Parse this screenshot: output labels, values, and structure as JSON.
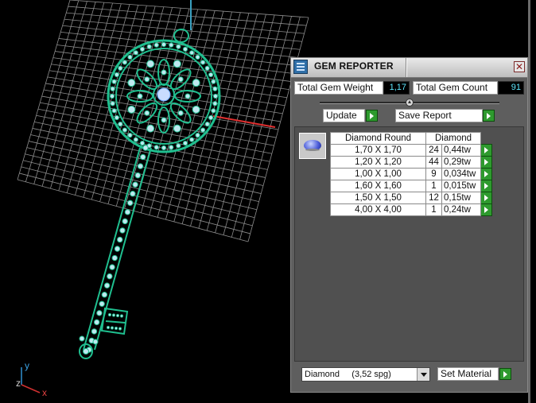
{
  "viewport": {
    "axis_labels": {
      "y": "y",
      "z": "z",
      "x": "x"
    },
    "colors": {
      "background": "#000000",
      "grid": "#8c8c8c",
      "model": "#1fbf8f",
      "axis_x": "#e03030",
      "axis_y": "#30a0e0"
    }
  },
  "panel": {
    "title": "GEM REPORTER",
    "close_icon": "close-x-icon",
    "total_gem_weight_label": "Total Gem Weight",
    "total_gem_weight_value": "1,17",
    "total_gem_count_label": "Total Gem Count",
    "total_gem_count_value": "91",
    "update_label": "Update",
    "save_report_label": "Save Report",
    "table": {
      "header_shape": "Diamond Round",
      "header_material": "Diamond",
      "rows": [
        {
          "size": "1,70 X 1,70",
          "count": "24",
          "weight": "0,44tw"
        },
        {
          "size": "1,20 X 1,20",
          "count": "44",
          "weight": "0,29tw"
        },
        {
          "size": "1,00 X 1,00",
          "count": "9",
          "weight": "0,034tw"
        },
        {
          "size": "1,60 X 1,60",
          "count": "1",
          "weight": "0,015tw"
        },
        {
          "size": "1,50 X 1,50",
          "count": "12",
          "weight": "0,15tw"
        },
        {
          "size": "4,00 X 4,00",
          "count": "1",
          "weight": "0,24tw"
        }
      ]
    },
    "material_value": "Diamond     (3,52 spg)",
    "set_material_label": "Set Material",
    "accent_green": "#2e9a2e",
    "value_color": "#5fe8ff"
  }
}
